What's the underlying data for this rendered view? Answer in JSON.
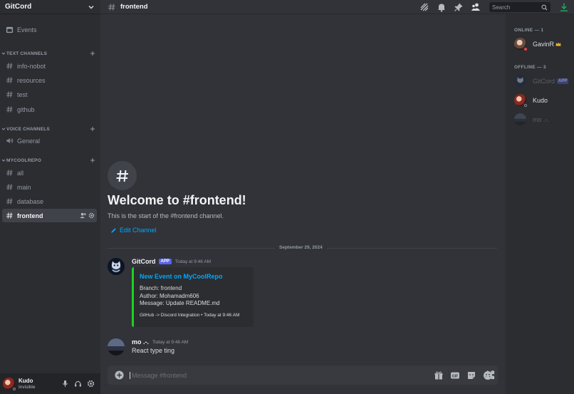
{
  "server": {
    "name": "GitCord"
  },
  "sidebar": {
    "events_label": "Events",
    "categories": [
      {
        "name": "TEXT CHANNELS",
        "channels": [
          "info-nobot",
          "resources",
          "test",
          "github"
        ]
      },
      {
        "name": "VOICE CHANNELS",
        "channels": [
          "General"
        ]
      },
      {
        "name": "MYCOOLREPO",
        "channels": [
          "all",
          "main",
          "database",
          "frontend"
        ]
      }
    ]
  },
  "user_panel": {
    "name": "Kudo",
    "status": "Invisible"
  },
  "topbar": {
    "channel": "frontend",
    "search_placeholder": "Search"
  },
  "welcome": {
    "title": "Welcome to #frontend!",
    "subtitle": "This is the start of the #frontend channel.",
    "edit_label": "Edit Channel"
  },
  "divider_date": "September 29, 2024",
  "messages": [
    {
      "author": "GitCord",
      "badge": "APP",
      "timestamp": "Today at 9:46 AM",
      "embed": {
        "title": "New Event on MyCoolRepo",
        "lines": [
          "Branch: frontend",
          "Author: Mohamadm606",
          "Message: Update README.md"
        ],
        "footer": "GitHub -> Discord Integration • Today at 9:46 AM",
        "accent": "#1fd024"
      }
    },
    {
      "author": "mo .-.",
      "timestamp": "Today at 9:46 AM",
      "text": "React type ting"
    }
  ],
  "composer": {
    "placeholder": "Message #frontend"
  },
  "members": {
    "online_header": "ONLINE — 1",
    "offline_header": "OFFLINE — 3",
    "online": [
      {
        "name": "GavinR",
        "status": "dnd",
        "crown": true
      }
    ],
    "offline": [
      {
        "name": "GitCord",
        "badge": "APP"
      },
      {
        "name": "Kudo"
      },
      {
        "name": "mo .-."
      }
    ]
  },
  "colors": {
    "accent": "#5865f2",
    "link": "#00a8fc",
    "embed_bar": "#1fd024",
    "download": "#23a55a"
  }
}
